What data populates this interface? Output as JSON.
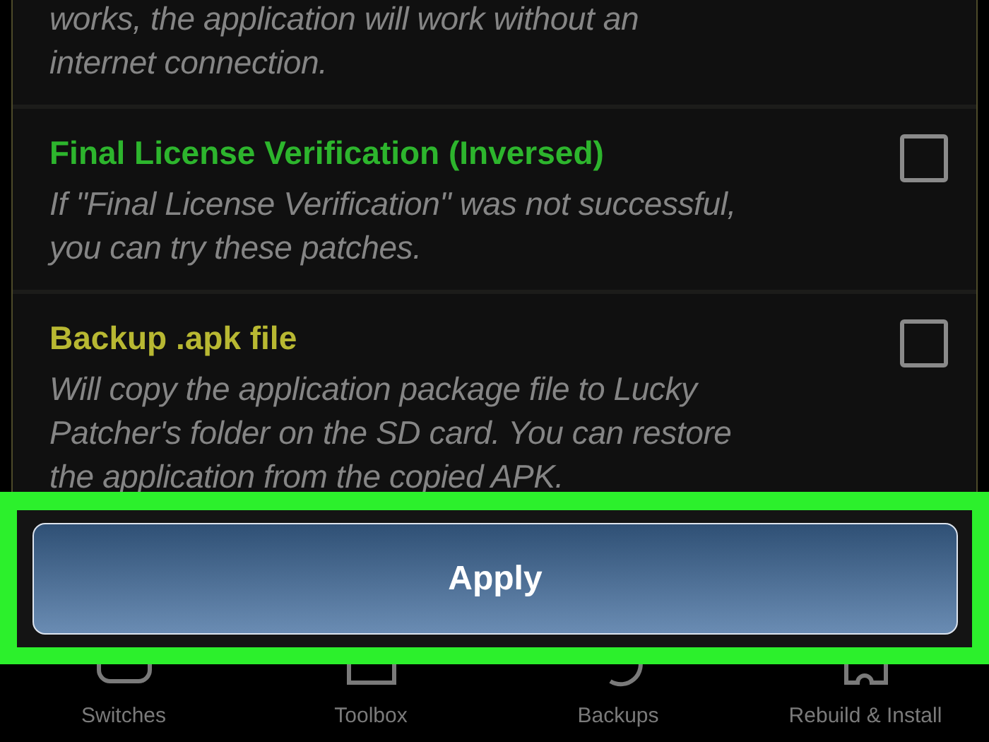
{
  "items": [
    {
      "description": "works, the application will work without an\ninternet connection."
    },
    {
      "title": "Final License Verification (Inversed)",
      "description": "If \"Final License Verification\" was not successful,\nyou can try these patches.",
      "color": "#2db52d",
      "checked": false
    },
    {
      "title": "Backup .apk file",
      "description": "Will copy the application package file to Lucky\nPatcher's folder on the SD card. You can restore\nthe application from the copied APK.",
      "color": "#b8b832",
      "checked": false
    }
  ],
  "apply_button": {
    "label": "Apply"
  },
  "bottom_nav": [
    {
      "label": "Switches",
      "kind": "toggle"
    },
    {
      "label": "Toolbox",
      "kind": "toolbox"
    },
    {
      "label": "Backups",
      "kind": "restore"
    },
    {
      "label": "Rebuild & Install",
      "kind": "puzzle"
    }
  ]
}
